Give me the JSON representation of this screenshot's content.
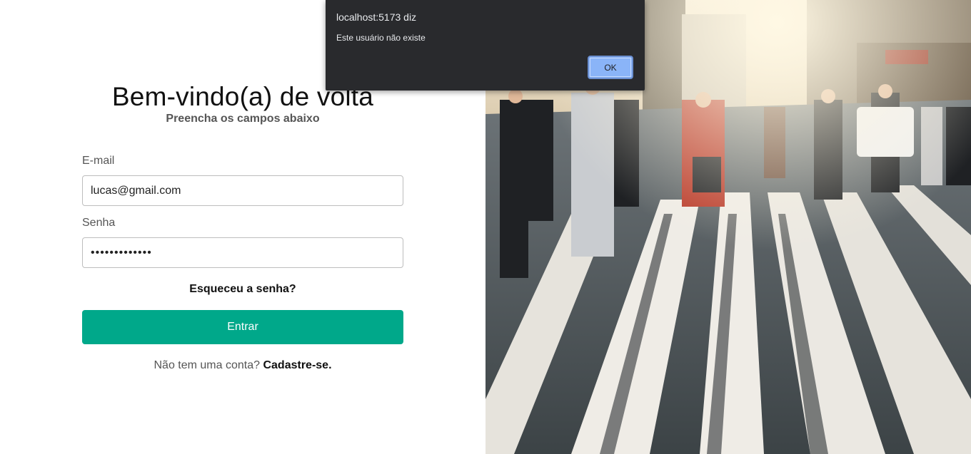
{
  "login": {
    "title": "Bem-vindo(a) de volta",
    "subtitle": "Preencha os campos abaixo",
    "email_label": "E-mail",
    "email_value": "lucas@gmail.com",
    "password_label": "Senha",
    "password_value": "•••••••••••••",
    "forgot_link": "Esqueceu a senha?",
    "submit_label": "Entrar",
    "signup_prompt": "Não tem uma conta?",
    "signup_link": "Cadastre-se."
  },
  "alert": {
    "origin": "localhost:5173 diz",
    "message": "Este usuário não existe",
    "ok_label": "OK"
  },
  "colors": {
    "accent": "#00a88a",
    "dialog_bg": "#292a2d",
    "dialog_button": "#8ab4f8"
  }
}
